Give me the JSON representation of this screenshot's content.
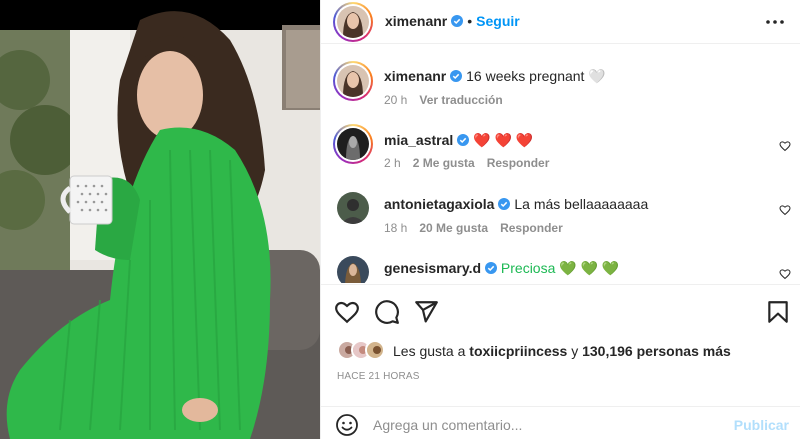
{
  "post": {
    "author": "ximenanr",
    "follow_label": "Seguir",
    "dot": "•",
    "caption_user": "ximenanr",
    "caption_text": "16 weeks pregnant 🤍",
    "caption_time": "20 h",
    "caption_translate": "Ver traducción"
  },
  "comments": [
    {
      "user": "mia_astral",
      "text": "❤️ ❤️ ❤️",
      "time": "2 h",
      "likes": "2 Me gusta",
      "reply": "Responder"
    },
    {
      "user": "antonietagaxiola",
      "text": "La más bellaaaaaaaa",
      "time": "18 h",
      "likes": "20 Me gusta",
      "reply": "Responder"
    },
    {
      "user": "genesismary.d",
      "text": "Preciosa 💚 💚 💚",
      "time": "",
      "likes": "",
      "reply": ""
    }
  ],
  "likes": {
    "prefix": "Les gusta a",
    "user": "toxiicpriincess",
    "middle": "y",
    "count": "130,196 personas más"
  },
  "timestamp": "HACE 21 HORAS",
  "composer": {
    "placeholder": "Agrega un comentario...",
    "publish_label": "Publicar"
  },
  "colors": {
    "link": "#0095f6",
    "publish_disabled": "#b2dffc",
    "muted": "#8e8e8e",
    "text": "#262626",
    "dress_green": "#2fb84a",
    "verified": "#3897f0"
  },
  "icons": {
    "more": "more-horizontal-icon",
    "like": "heart-icon",
    "comment": "comment-icon",
    "share": "send-icon",
    "save": "bookmark-icon",
    "emoji": "emoji-icon",
    "verified": "verified-badge-icon"
  }
}
